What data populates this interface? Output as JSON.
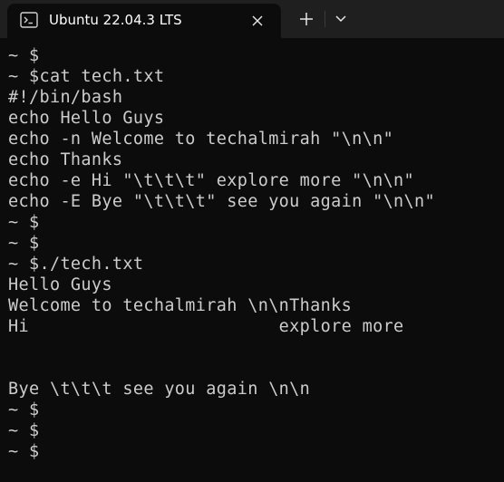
{
  "window": {
    "tab_title": "Ubuntu 22.04.3 LTS",
    "tab_icon": "terminal-icon",
    "close_icon": "close-icon",
    "new_tab_icon": "plus-icon",
    "dropdown_icon": "chevron-down-icon"
  },
  "colors": {
    "terminal_bg": "#0c0c0c",
    "titlebar_bg": "#1f1f1f",
    "text": "#cccccc",
    "title_text": "#ffffff"
  },
  "terminal": {
    "lines": [
      "~ $",
      "~ $cat tech.txt",
      "#!/bin/bash",
      "echo Hello Guys",
      "echo -n Welcome to techalmirah \"\\n\\n\"",
      "echo Thanks",
      "echo -e Hi \"\\t\\t\\t\" explore more \"\\n\\n\"",
      "echo -E Bye \"\\t\\t\\t\" see you again \"\\n\\n\"",
      "~ $",
      "~ $",
      "~ $./tech.txt",
      "Hello Guys",
      "Welcome to techalmirah \\n\\nThanks",
      "Hi                        explore more",
      "",
      "",
      "Bye \\t\\t\\t see you again \\n\\n",
      "~ $",
      "~ $",
      "~ $"
    ]
  }
}
